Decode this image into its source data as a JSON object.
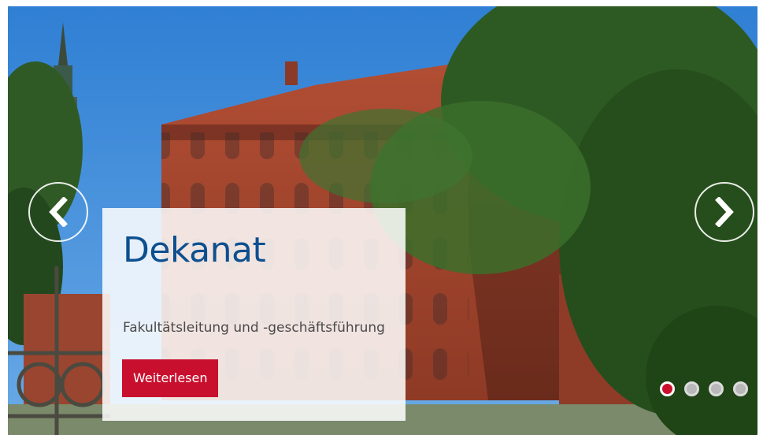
{
  "slide": {
    "title": "Dekanat",
    "subtitle": "Fakultätsleitung und -geschäftsführung",
    "button_label": "Weiterlesen",
    "image_subject": "red brick university building with church tower and tree"
  },
  "controls": {
    "prev_icon": "chevron-left-icon",
    "next_icon": "chevron-right-icon"
  },
  "pagination": {
    "total": 4,
    "active_index": 0
  },
  "colors": {
    "title": "#0d4f8f",
    "button": "#c8102e",
    "active_dot": "#c8102e",
    "sky": "#3f8ad6",
    "brick": "#a0442c"
  }
}
